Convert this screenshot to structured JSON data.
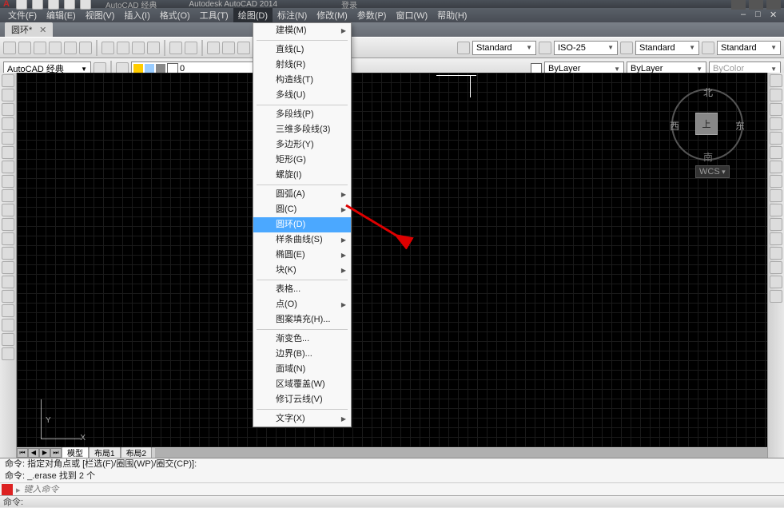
{
  "title": "Autodesk AutoCAD 2014",
  "workspace_tab": "AutoCAD 经典",
  "login_hint": "登录",
  "menubar": {
    "items": [
      "文件(F)",
      "编辑(E)",
      "视图(V)",
      "插入(I)",
      "格式(O)",
      "工具(T)",
      "绘图(D)",
      "标注(N)",
      "修改(M)",
      "参数(P)",
      "窗口(W)",
      "帮助(H)"
    ]
  },
  "doctab": {
    "name": "圆环*",
    "close": "✕"
  },
  "std_dd1": "Standard",
  "std_dd2": "ISO-25",
  "std_dd3": "Standard",
  "std_dd4": "Standard",
  "workspace": "AutoCAD 经典",
  "layer": {
    "current": "0",
    "linetype": "ByLayer",
    "lineweight": "ByLayer",
    "color": "ByColor"
  },
  "model_tabs": [
    "模型",
    "布局1",
    "布局2"
  ],
  "cmd": {
    "hist1": "命令: 指定对角点或 [栏选(F)/圈围(WP)/圈交(CP)]:",
    "hist2": "命令: _.erase 找到 2 个",
    "placeholder": "键入命令"
  },
  "status": "命令:",
  "viewcube": {
    "n": "北",
    "s": "南",
    "e": "东",
    "w": "西",
    "top": "上",
    "wcs": "WCS"
  },
  "ucs": {
    "y": "Y",
    "x": "X"
  },
  "draw_menu": {
    "modeling": "建模(M)",
    "line": "直线(L)",
    "ray": "射线(R)",
    "cline": "构造线(T)",
    "mline": "多线(U)",
    "pline": "多段线(P)",
    "pline3d": "三维多段线(3)",
    "polygon": "多边形(Y)",
    "rect": "矩形(G)",
    "helix": "螺旋(I)",
    "arc": "圆弧(A)",
    "circle": "圆(C)",
    "donut": "圆环(D)",
    "spline": "样条曲线(S)",
    "ellipse": "椭圆(E)",
    "block": "块(K)",
    "table": "表格...",
    "point": "点(O)",
    "hatch": "图案填充(H)...",
    "gradient": "渐变色...",
    "boundary": "边界(B)...",
    "region": "面域(N)",
    "regioncover": "区域覆盖(W)",
    "revcloud": "修订云线(V)",
    "text": "文字(X)"
  }
}
